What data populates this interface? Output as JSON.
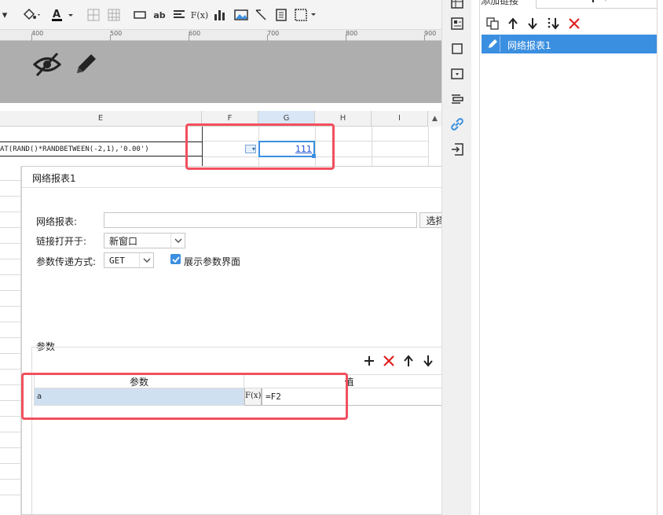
{
  "toolbar": {
    "text_btn": "ab",
    "formula_btn": "F(x)"
  },
  "ruler": {
    "ticks": [
      "400",
      "500",
      "600",
      "700",
      "800",
      "900"
    ]
  },
  "sheet": {
    "columns": [
      "E",
      "F",
      "G",
      "H",
      "I"
    ],
    "formula_text": "AT(RAND()*RANDBETWEEN(-2,1),'0.00')",
    "g2_value": "111"
  },
  "link_panel": {
    "title": "添加链接",
    "item_label": "网络报表1"
  },
  "dialog": {
    "title": "网络报表1",
    "report_label": "网络报表:",
    "report_value": "",
    "select_button": "选择",
    "open_in_label": "链接打开于:",
    "open_in_value": "新窗口",
    "method_label": "参数传递方式:",
    "method_value": "GET",
    "show_params_label": "展示参数界面",
    "show_params_checked": true,
    "params_section": "参数",
    "param_table": {
      "col_param": "参数",
      "col_value": "值",
      "rows": [
        {
          "name": "a",
          "formula_marker": "F(x)",
          "value": "=F2"
        }
      ]
    }
  },
  "colors": {
    "accent": "#3b8fe0",
    "highlight_red": "#f2505f",
    "delete_red": "#e02020",
    "selected_row": "#cfe0f1"
  }
}
